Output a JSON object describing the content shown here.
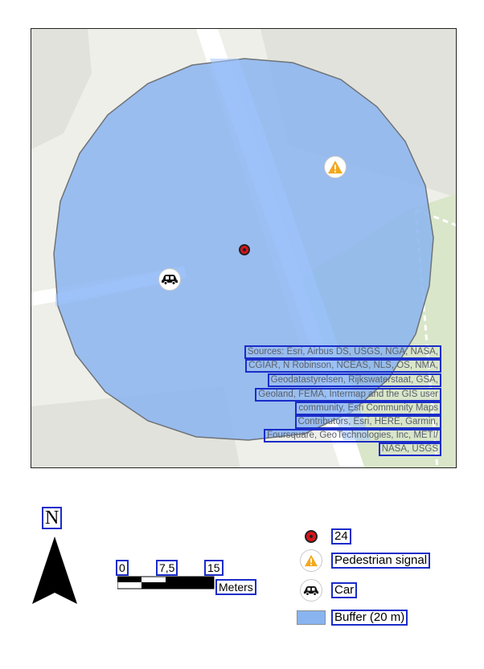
{
  "map": {
    "attribution": [
      "Sources: Esri, Airbus DS, USGS, NGA, NASA,",
      "CGIAR, N Robinson, NCEAS, NLS, OS, NMA,",
      "Geodatastyrelsen, Rijkswaterstaat, GSA,",
      "Geoland, FEMA, Intermap and the GIS user",
      "community, Esri Community Maps",
      "Contributors, Esri, HERE, Garmin,",
      "Foursquare, GeoTechnologies, Inc, METI/",
      "NASA, USGS"
    ],
    "markers": [
      {
        "name": "poi-24",
        "icon": "target-dot-icon"
      },
      {
        "name": "pedestrian-signal",
        "icon": "warning-triangle-icon"
      },
      {
        "name": "car",
        "icon": "car-icon"
      }
    ],
    "buffer_color": "#8ab4f0"
  },
  "north_arrow": {
    "label": "N"
  },
  "scalebar": {
    "ticks": [
      "0",
      "7,5",
      "15"
    ],
    "unit": "Meters"
  },
  "legend": {
    "items": [
      {
        "label": "24",
        "icon": "target-dot-icon"
      },
      {
        "label": "Pedestrian signal",
        "icon": "warning-triangle-icon"
      },
      {
        "label": "Car",
        "icon": "car-icon"
      },
      {
        "label": "Buffer (20 m)",
        "icon": "buffer-swatch"
      }
    ]
  }
}
